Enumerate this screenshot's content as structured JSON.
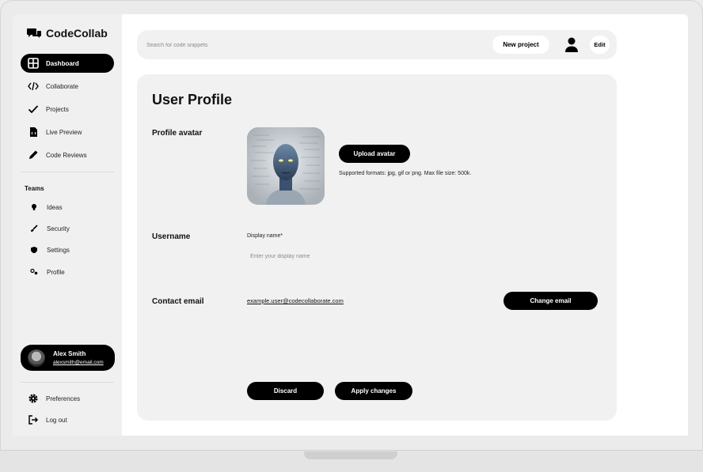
{
  "brand": {
    "name": "CodeCollab",
    "icon": "chat-bubbles-icon"
  },
  "nav": [
    {
      "label": "Dashboard",
      "icon": "dashboard-grid-icon",
      "active": true
    },
    {
      "label": "Collaborate",
      "icon": "code-brackets-icon"
    },
    {
      "label": "Projects",
      "icon": "checkmark-icon"
    },
    {
      "label": "Live Preview",
      "icon": "file-code-icon"
    },
    {
      "label": "Code Reviews",
      "icon": "pencil-icon"
    }
  ],
  "teams": {
    "label": "Teams",
    "items": [
      {
        "label": "Ideas",
        "icon": "lightbulb-icon"
      },
      {
        "label": "Security",
        "icon": "brush-icon"
      },
      {
        "label": "Settings",
        "icon": "shield-icon"
      },
      {
        "label": "Profile",
        "icon": "nodes-icon"
      }
    ]
  },
  "user": {
    "name": "Alex Smith",
    "email": "alexsmith@email.com"
  },
  "footer_nav": [
    {
      "label": "Preferences",
      "icon": "gear-icon"
    },
    {
      "label": "Log out",
      "icon": "logout-icon"
    }
  ],
  "topbar": {
    "search_placeholder": "Search for code snippets",
    "new_project_label": "New project",
    "edit_label": "Edit"
  },
  "profile": {
    "title": "User Profile",
    "avatar_label": "Profile avatar",
    "upload_label": "Upload avatar",
    "formats_hint": "Supported formats: jpg, gif or png. Max file size: 500k.",
    "username_label": "Username",
    "display_name_label": "Display name*",
    "display_name_placeholder": "Enter your display name",
    "display_name_value": "",
    "email_label": "Contact email",
    "email_value": "example.user@codecollaborate.com",
    "change_email_label": "Change email",
    "discard_label": "Discard",
    "apply_label": "Apply changes"
  }
}
